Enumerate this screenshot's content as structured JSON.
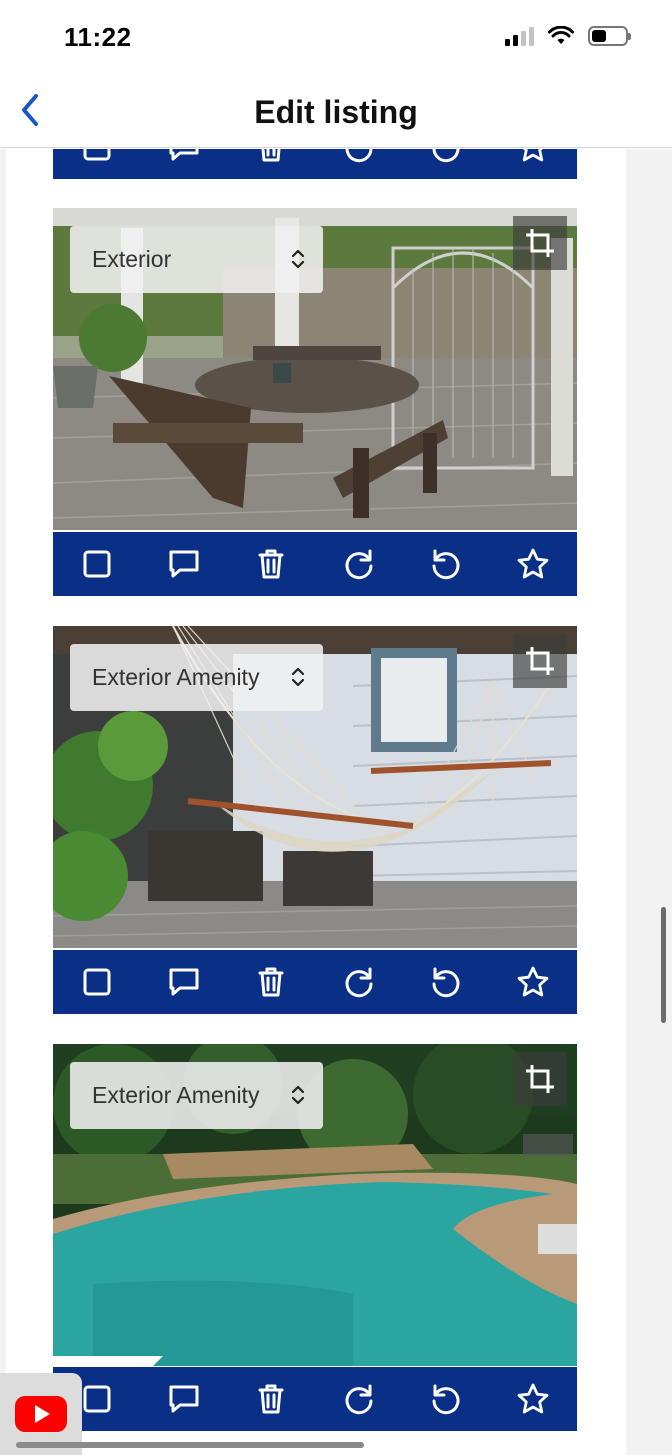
{
  "status_bar": {
    "time": "11:22"
  },
  "nav": {
    "title": "Edit listing"
  },
  "photos": [
    {
      "category": "Exterior"
    },
    {
      "category": "Exterior Amenity"
    },
    {
      "category": "Exterior Amenity"
    }
  ],
  "toolbar_icons": [
    "checkbox-icon",
    "comment-icon",
    "trash-icon",
    "rotate-clockwise-icon",
    "rotate-counterclockwise-icon",
    "star-icon"
  ],
  "colors": {
    "toolbar": "#0a2f87",
    "back_arrow": "#1a56c4",
    "youtube": "#ff0000"
  }
}
